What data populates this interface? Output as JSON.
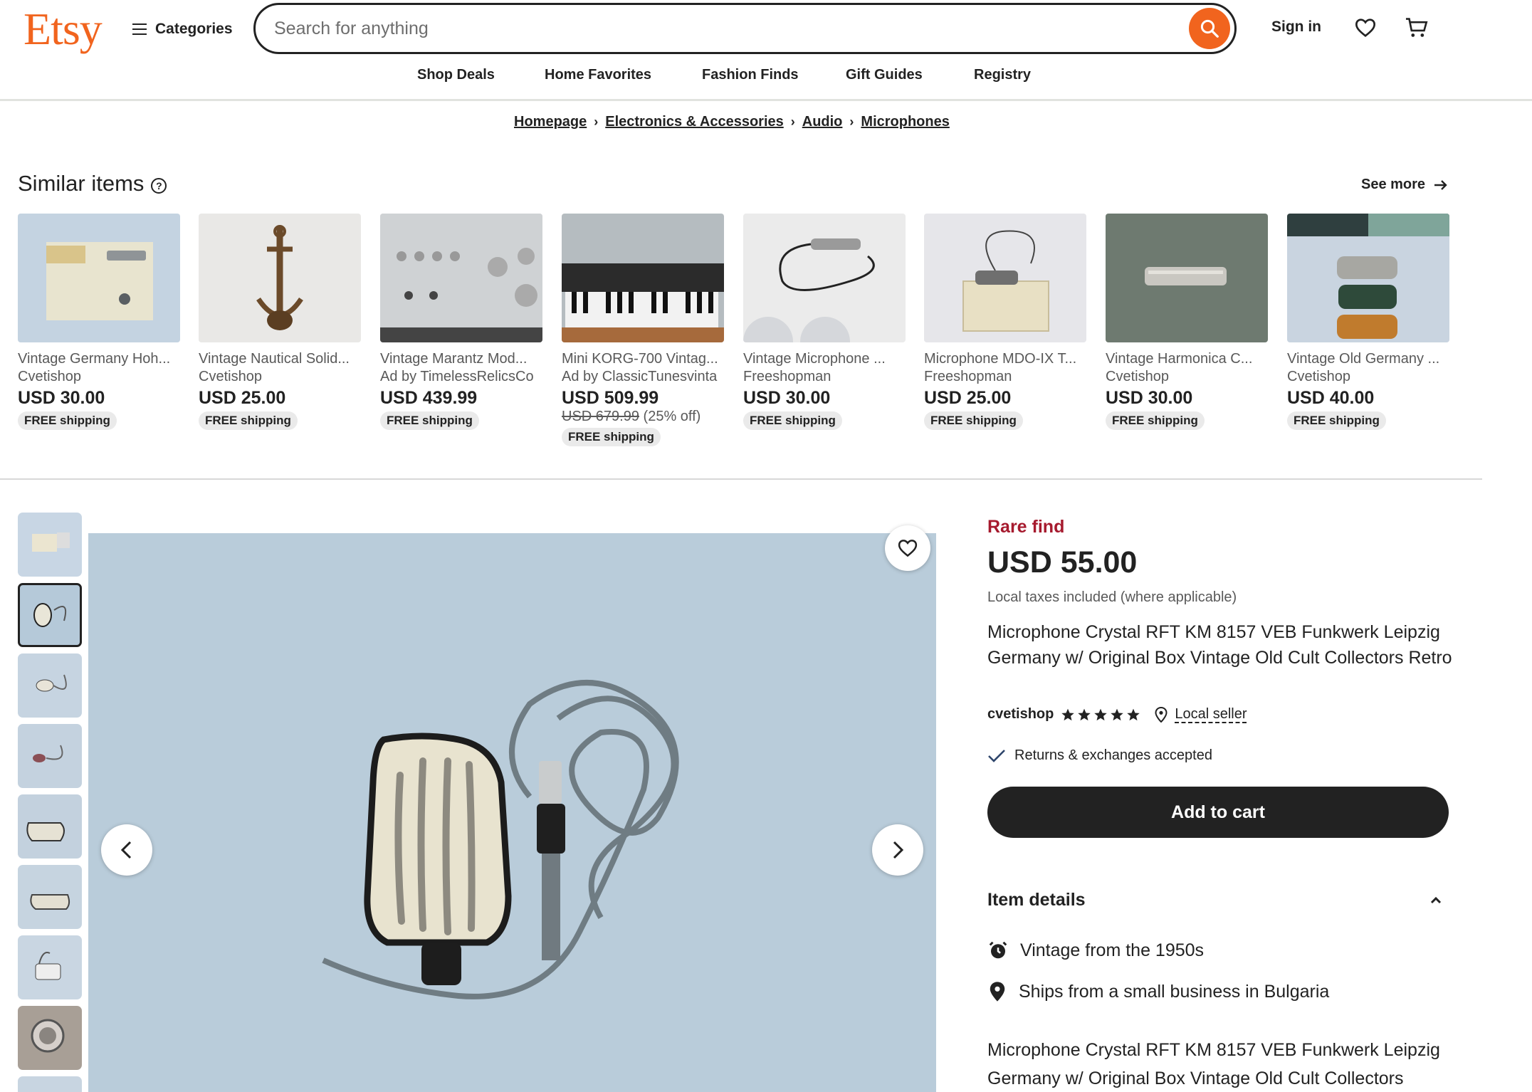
{
  "header": {
    "logo": "Etsy",
    "categories_label": "Categories",
    "search_placeholder": "Search for anything",
    "sign_in": "Sign in",
    "accent_color": "#f1641e"
  },
  "nav": [
    "Shop Deals",
    "Home Favorites",
    "Fashion Finds",
    "Gift Guides",
    "Registry"
  ],
  "breadcrumb": [
    "Homepage",
    "Electronics & Accessories",
    "Audio",
    "Microphones"
  ],
  "similar": {
    "title": "Similar items",
    "see_more": "See more",
    "items": [
      {
        "title": "Vintage Germany Hoh...",
        "shop": "Cvetishop",
        "price": "USD 30.00",
        "shipping": "FREE shipping"
      },
      {
        "title": "Vintage Nautical Solid...",
        "shop": "Cvetishop",
        "price": "USD 25.00",
        "shipping": "FREE shipping"
      },
      {
        "title": "Vintage Marantz Mod...",
        "shop": "Ad by TimelessRelicsCo",
        "price": "USD 439.99",
        "shipping": "FREE shipping"
      },
      {
        "title": "Mini KORG-700 Vintag...",
        "shop": "Ad by ClassicTunesvinta",
        "price": "USD 509.99",
        "original_price": "USD 679.99",
        "discount": "(25% off)",
        "shipping": "FREE shipping"
      },
      {
        "title": "Vintage Microphone ...",
        "shop": "Freeshopman",
        "price": "USD 30.00",
        "shipping": "FREE shipping"
      },
      {
        "title": "Microphone MDO-IX T...",
        "shop": "Freeshopman",
        "price": "USD 25.00",
        "shipping": "FREE shipping"
      },
      {
        "title": "Vintage Harmonica C...",
        "shop": "Cvetishop",
        "price": "USD 30.00",
        "shipping": "FREE shipping"
      },
      {
        "title": "Vintage Old Germany ...",
        "shop": "Cvetishop",
        "price": "USD 40.00",
        "shipping": "FREE shipping"
      }
    ]
  },
  "listing": {
    "badge": "Rare find",
    "badge_color": "#a61a2e",
    "price": "USD 55.00",
    "taxes": "Local taxes included (where applicable)",
    "title": "Microphone Crystal RFT KM 8157 VEB Funkwerk Leipzig Germany w/ Original Box Vintage Old Cult Collectors Retro",
    "shop": "cvetishop",
    "rating": 5,
    "local_seller": "Local seller",
    "returns": "Returns & exchanges accepted",
    "add_to_cart": "Add to cart",
    "details_header": "Item details",
    "details": [
      "Vintage from the 1950s",
      "Ships from a small business in Bulgaria"
    ],
    "description": "Microphone Crystal RFT KM 8157 VEB Funkwerk Leipzig Germany w/ Original Box Vintage Old Cult Collectors"
  }
}
